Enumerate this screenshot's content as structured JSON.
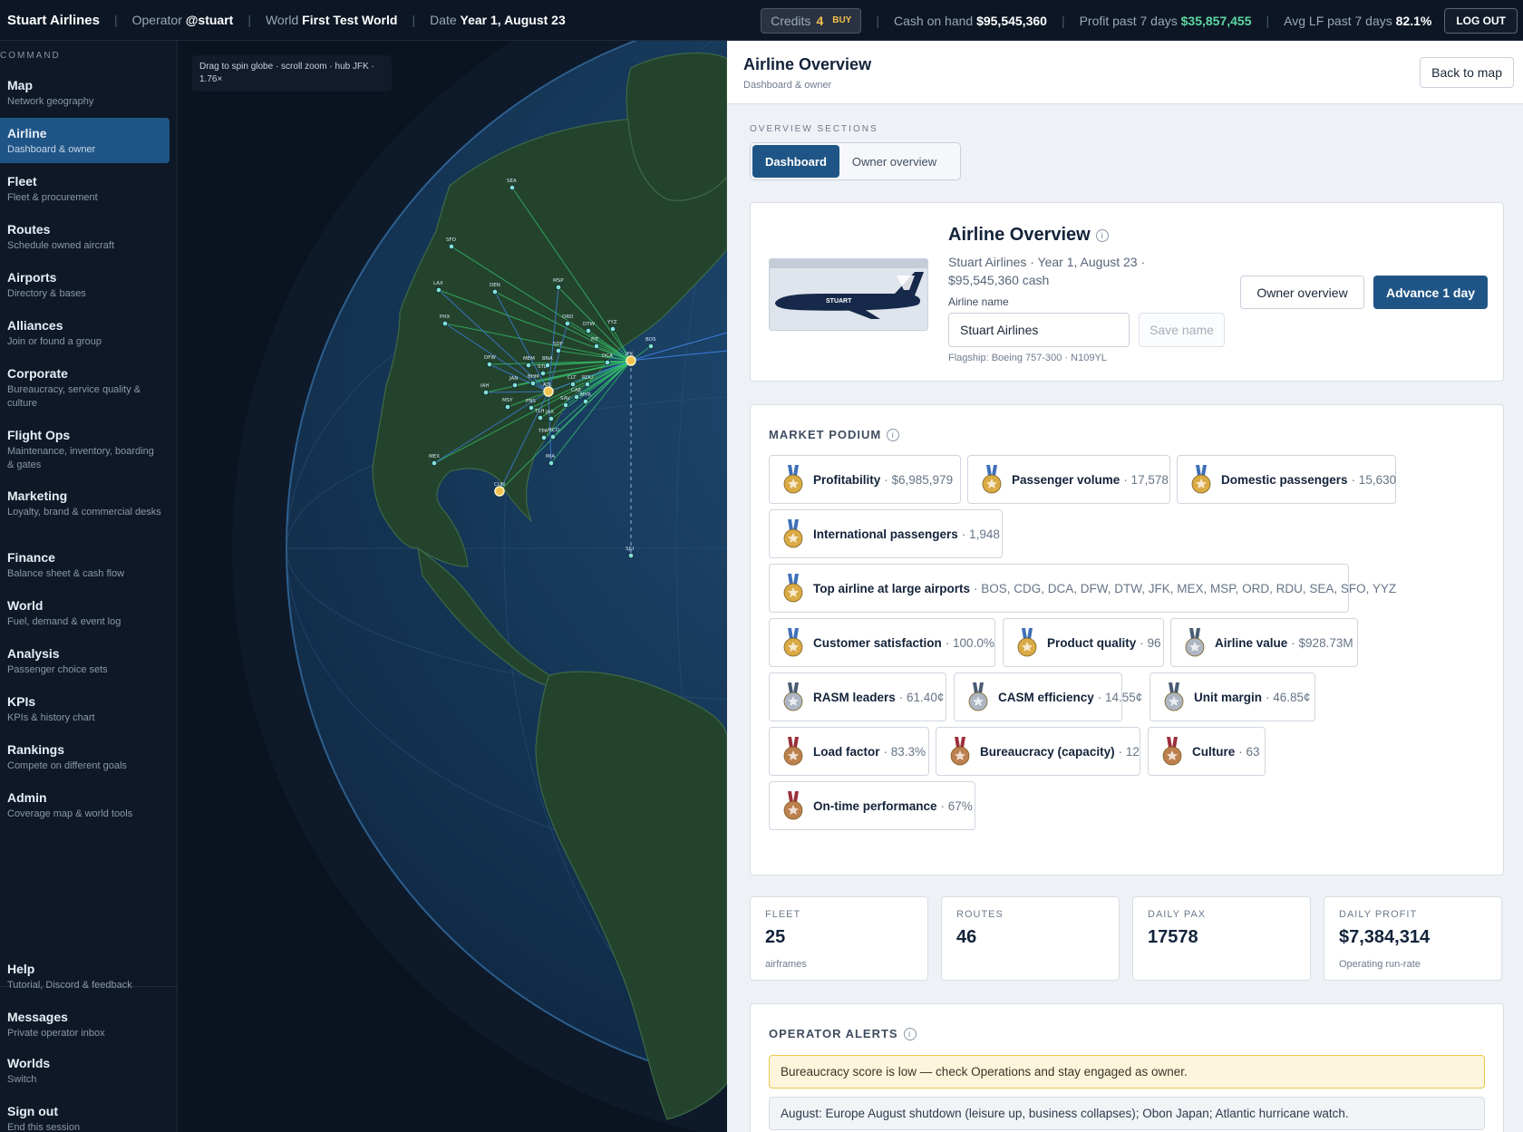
{
  "topbar": {
    "brand": "Stuart Airlines",
    "operator_label": "Operator",
    "operator_value": "@stuart",
    "world_label": "World",
    "world_value": "First Test World",
    "date_label": "Date",
    "date_value": "Year 1, August 23",
    "credits_label": "Credits",
    "credits_value": "4",
    "buy_label": "BUY",
    "cash_label": "Cash on hand",
    "cash_value": "$95,545,360",
    "profit_label": "Profit past 7 days",
    "profit_value": "$35,857,455",
    "lf_label": "Avg LF past 7 days",
    "lf_value": "82.1%",
    "logout_label": "LOG OUT"
  },
  "sidebar": {
    "category": "COMMAND",
    "items": [
      {
        "title": "Map",
        "sub": "Network geography"
      },
      {
        "title": "Airline",
        "sub": "Dashboard & owner"
      },
      {
        "title": "Fleet",
        "sub": "Fleet & procurement"
      },
      {
        "title": "Routes",
        "sub": "Schedule owned aircraft"
      },
      {
        "title": "Airports",
        "sub": "Directory & bases"
      },
      {
        "title": "Alliances",
        "sub": "Join or found a group"
      },
      {
        "title": "Corporate",
        "sub": "Bureaucracy, service quality & culture"
      },
      {
        "title": "Flight Ops",
        "sub": "Maintenance, inventory, boarding & gates"
      },
      {
        "title": "Marketing",
        "sub": "Loyalty, brand & commercial desks"
      },
      {
        "title": "Finance",
        "sub": "Balance sheet & cash flow"
      },
      {
        "title": "World",
        "sub": "Fuel, demand & event log"
      },
      {
        "title": "Analysis",
        "sub": "Passenger choice sets"
      },
      {
        "title": "KPIs",
        "sub": "KPIs & history chart"
      },
      {
        "title": "Rankings",
        "sub": "Compete on different goals"
      },
      {
        "title": "Admin",
        "sub": "Coverage map & world tools"
      }
    ],
    "bottom": [
      {
        "title": "Help",
        "sub": "Tutorial, Discord & feedback"
      },
      {
        "title": "Messages",
        "sub": "Private operator inbox"
      },
      {
        "title": "Worlds",
        "sub": "Switch"
      },
      {
        "title": "Sign out",
        "sub": "End this session"
      }
    ]
  },
  "globe": {
    "tip": "Drag to spin globe · scroll zoom · hub JFK · 1.76×",
    "airports": [
      "SEA",
      "SFO",
      "LAX",
      "PHX",
      "DEN",
      "MSP",
      "ORD",
      "DTW",
      "YYZ",
      "BOS",
      "JFK",
      "PIT",
      "SDF",
      "DCA",
      "DFW",
      "MEM",
      "BNA",
      "STL",
      "CLT",
      "RDU",
      "IAH",
      "JAN",
      "BHM",
      "ATL",
      "MSY",
      "PNS",
      "CAE",
      "MYR",
      "SAV",
      "TLH",
      "JAX",
      "TPA",
      "MCO",
      "MIA",
      "MEX",
      "CUN",
      "SJU"
    ]
  },
  "panel": {
    "title": "Airline Overview",
    "subtitle": "Dashboard & owner",
    "back_label": "Back to map",
    "sections_label": "OVERVIEW SECTIONS",
    "tabs": [
      "Dashboard",
      "Owner overview"
    ],
    "overview": {
      "title": "Airline Overview",
      "livery_text": "STUART",
      "meta": "Stuart Airlines · Year 1, August 23 · $95,545,360 cash",
      "name_label": "Airline name",
      "name_value": "Stuart Airlines",
      "save_label": "Save name",
      "flagship": "Flagship: Boeing 757-300 · N109YL",
      "owner_btn": "Owner overview",
      "advance_btn": "Advance 1 day"
    },
    "podium": {
      "title": "MARKET PODIUM",
      "items": [
        {
          "label": "Profitability",
          "value": "· $6,985,979",
          "medal": "gold"
        },
        {
          "label": "Passenger volume",
          "value": "· 17,578",
          "medal": "gold"
        },
        {
          "label": "Domestic passengers",
          "value": "· 15,630",
          "medal": "gold"
        },
        {
          "label": "International passengers",
          "value": "· 1,948",
          "medal": "gold"
        },
        {
          "label": "Top airline at large airports",
          "value": "· BOS, CDG, DCA, DFW, DTW, JFK, MEX, MSP, ORD, RDU, SEA, SFO, YYZ",
          "medal": "gold"
        },
        {
          "label": "Customer satisfaction",
          "value": "· 100.0%",
          "medal": "gold"
        },
        {
          "label": "Product quality",
          "value": "· 96",
          "medal": "gold"
        },
        {
          "label": "Airline value",
          "value": "· $928.73M",
          "medal": "silver"
        },
        {
          "label": "RASM leaders",
          "value": "· 61.40¢",
          "medal": "silver"
        },
        {
          "label": "CASM efficiency",
          "value": "· 14.55¢",
          "medal": "silver"
        },
        {
          "label": "Unit margin",
          "value": "· 46.85¢",
          "medal": "silver"
        },
        {
          "label": "Load factor",
          "value": "· 83.3%",
          "medal": "bronze"
        },
        {
          "label": "Bureaucracy (capacity)",
          "value": "· 12",
          "medal": "bronze"
        },
        {
          "label": "Culture",
          "value": "· 63",
          "medal": "bronze"
        },
        {
          "label": "On-time performance",
          "value": "· 67%",
          "medal": "bronze"
        }
      ]
    },
    "stats": [
      {
        "label": "FLEET",
        "value": "25",
        "sub": "airframes"
      },
      {
        "label": "ROUTES",
        "value": "46",
        "sub": ""
      },
      {
        "label": "DAILY PAX",
        "value": "17578",
        "sub": ""
      },
      {
        "label": "DAILY PROFIT",
        "value": "$7,384,314",
        "sub": "Operating run-rate"
      }
    ],
    "alerts": {
      "title": "OPERATOR ALERTS",
      "items": [
        "Bureaucracy score is low — check Operations and stay engaged as owner.",
        "August: Europe August shutdown (leisure up, business collapses); Obon Japan; Atlantic hurricane watch."
      ]
    }
  },
  "colors": {
    "accent": "#1f5586",
    "gold": "#d9a63a",
    "silver": "#a9b3bf",
    "bronze": "#b97a45",
    "route_green": "#35c46b",
    "route_blue": "#3d7fe0"
  }
}
